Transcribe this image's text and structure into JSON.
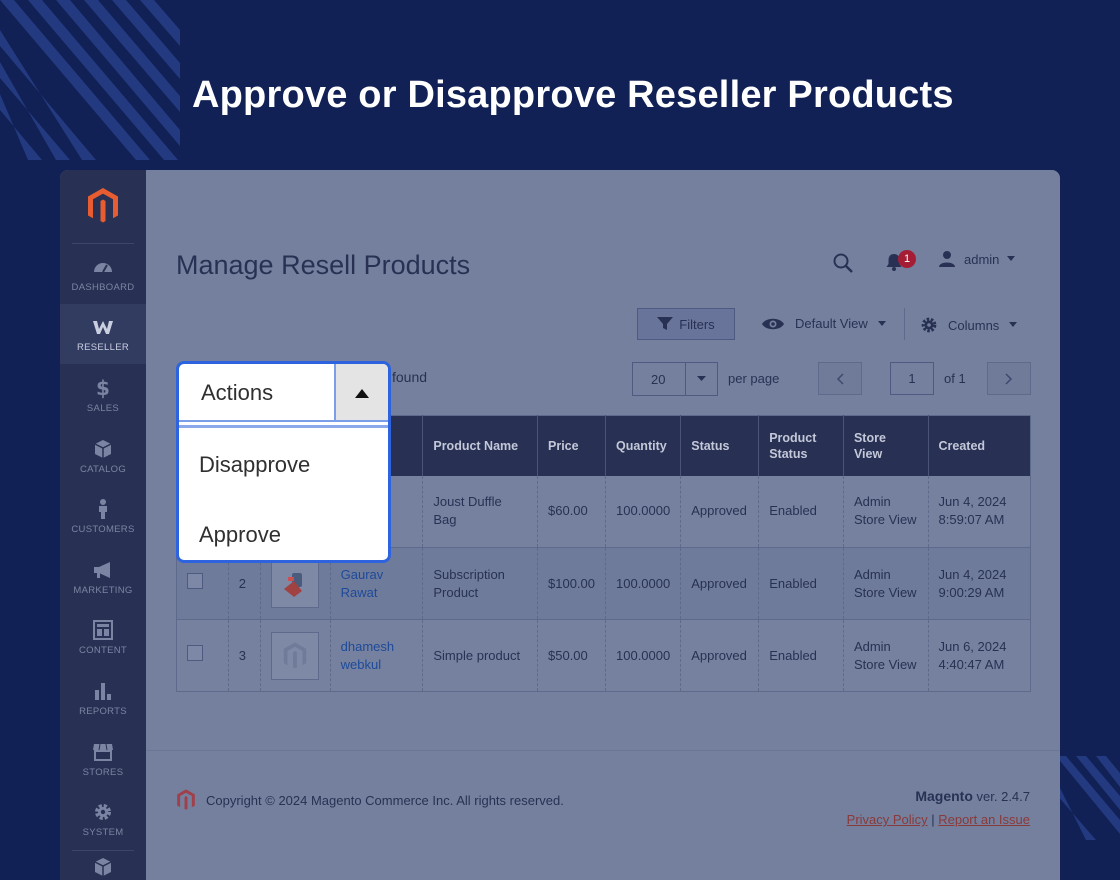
{
  "headline": "Approve or Disapprove Reseller Products",
  "sidebar": {
    "items": [
      {
        "label": "DASHBOARD",
        "icon": "dashboard-icon"
      },
      {
        "label": "RESELLER",
        "icon": "reseller-icon"
      },
      {
        "label": "SALES",
        "icon": "dollar-icon"
      },
      {
        "label": "CATALOG",
        "icon": "box-icon"
      },
      {
        "label": "CUSTOMERS",
        "icon": "person-icon"
      },
      {
        "label": "MARKETING",
        "icon": "megaphone-icon"
      },
      {
        "label": "CONTENT",
        "icon": "layout-icon"
      },
      {
        "label": "REPORTS",
        "icon": "bar-chart-icon"
      },
      {
        "label": "STORES",
        "icon": "storefront-icon"
      },
      {
        "label": "SYSTEM",
        "icon": "gear-icon"
      }
    ]
  },
  "page": {
    "title": "Manage Resell Products"
  },
  "header": {
    "notifications": "1",
    "user": "admin"
  },
  "toolbar": {
    "filters": "Filters",
    "default_view": "Default View",
    "columns": "Columns"
  },
  "records": {
    "found_text": "found"
  },
  "pagination": {
    "per_page_value": "20",
    "per_page_label": "per page",
    "page": "1",
    "of": "of 1"
  },
  "table": {
    "headers": [
      "Product Name",
      "Price",
      "Quantity",
      "Status",
      "Product Status",
      "Store View",
      "Created"
    ],
    "rows": [
      {
        "id": "",
        "reseller": "",
        "name": "Joust Duffle Bag",
        "price": "$60.00",
        "qty": "100.0000",
        "status": "Approved",
        "pstatus": "Enabled",
        "store": "Admin Store View",
        "created": "Jun 4, 2024 8:59:07 AM"
      },
      {
        "id": "2",
        "reseller": "Gaurav Rawat",
        "name": "Subscription Product",
        "price": "$100.00",
        "qty": "100.0000",
        "status": "Approved",
        "pstatus": "Enabled",
        "store": "Admin Store View",
        "created": "Jun 4, 2024 9:00:29 AM"
      },
      {
        "id": "3",
        "reseller": "dhamesh webkul",
        "name": "Simple product",
        "price": "$50.00",
        "qty": "100.0000",
        "status": "Approved",
        "pstatus": "Enabled",
        "store": "Admin Store View",
        "created": "Jun 6, 2024 4:40:47 AM"
      }
    ]
  },
  "actions": {
    "label": "Actions",
    "options": [
      "Disapprove",
      "Approve"
    ]
  },
  "footer": {
    "copyright": "Copyright © 2024 Magento Commerce Inc. All rights reserved.",
    "brand": "Magento",
    "version": " ver. 2.4.7",
    "privacy": "Privacy Policy",
    "separator": "|",
    "report": "Report an Issue"
  },
  "colors": {
    "background": "#112055",
    "sidebar": "#283153",
    "accent": "#2e63e0",
    "badge": "#a51d35"
  }
}
